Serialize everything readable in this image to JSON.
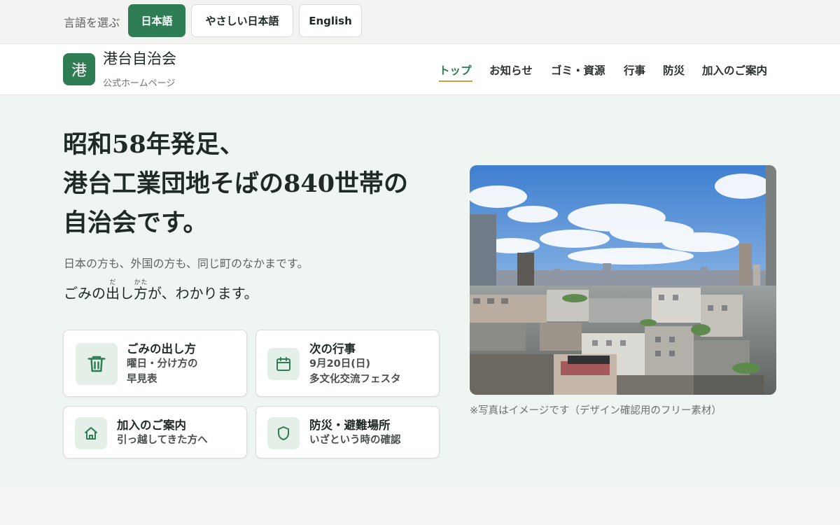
{
  "language_bar": {
    "label": "言語を選ぶ",
    "options": [
      "日本語",
      "やさしい日本語",
      "English"
    ],
    "selected": "日本語"
  },
  "header": {
    "logo_char": "港",
    "site_name": "港台自治会",
    "site_sub": "公式ホームページ",
    "nav": [
      "トップ",
      "お知らせ",
      "ゴミ・資源",
      "行事",
      "防災",
      "加入のご案内"
    ],
    "active_nav": "トップ"
  },
  "hero": {
    "headline": [
      "昭和58年発足、",
      "港台工業団地そばの840世帯の",
      "自治会です。"
    ],
    "subtitle": "日本の方も、外国の方も、同じ町のなかまです。",
    "ruby_line": {
      "before": "ごみの",
      "kanji1": "出",
      "ruby1": "だ",
      "middle": "し",
      "kanji2": "方",
      "ruby2": "かた",
      "after": "が、わかります。"
    }
  },
  "cards": [
    {
      "title": "ごみの出し方",
      "desc": [
        "曜日・分け方の",
        "早見表"
      ],
      "icon": "trash-icon"
    },
    {
      "title": "次の行事",
      "desc": [
        "9月20日(日)",
        "多文化交流フェスタ"
      ],
      "icon": "calendar-icon"
    },
    {
      "title": "加入のご案内",
      "desc": [
        "引っ越してきた方へ"
      ],
      "icon": "home-icon"
    },
    {
      "title": "防災・避難場所",
      "desc": [
        "いざという時の確認"
      ],
      "icon": "shield-icon"
    }
  ],
  "photo": {
    "caption": "※写真はイメージです（デザイン確認用のフリー素材）"
  },
  "colors": {
    "accent": "#2e7d54",
    "nav_underline": "#d89a3c",
    "hero_bg": "#eff5f0",
    "icon_tint": "#e4efe7"
  }
}
